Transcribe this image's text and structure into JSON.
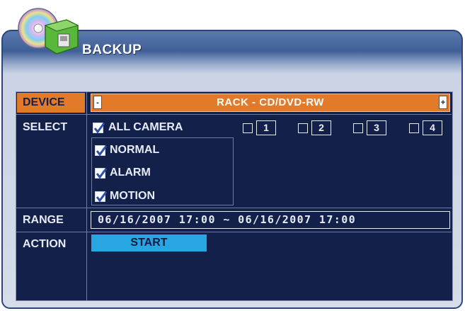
{
  "window": {
    "title": "BACKUP"
  },
  "labels": {
    "device": "DEVICE",
    "select": "SELECT",
    "range": "RANGE",
    "action": "ACTION"
  },
  "device": {
    "value": "RACK - CD/DVD-RW",
    "prev_symbol": "-",
    "next_symbol": "+"
  },
  "select": {
    "all_camera": {
      "label": "ALL CAMERA",
      "checked": true
    },
    "cameras": [
      {
        "label": "1",
        "checked": false
      },
      {
        "label": "2",
        "checked": false
      },
      {
        "label": "3",
        "checked": false
      },
      {
        "label": "4",
        "checked": false
      }
    ],
    "events": [
      {
        "label": "NORMAL",
        "checked": true
      },
      {
        "label": "ALARM",
        "checked": true
      },
      {
        "label": "MOTION",
        "checked": true
      }
    ]
  },
  "range": {
    "text": "06/16/2007 17:00 ~ 06/16/2007 17:00"
  },
  "action": {
    "start_label": "START"
  },
  "colors": {
    "panel_bg": "#13204a",
    "highlight": "#e27a2a",
    "button": "#28a6e4",
    "text": "#e6ebf5"
  },
  "icons": {
    "logo": "backup-disc-icon"
  }
}
